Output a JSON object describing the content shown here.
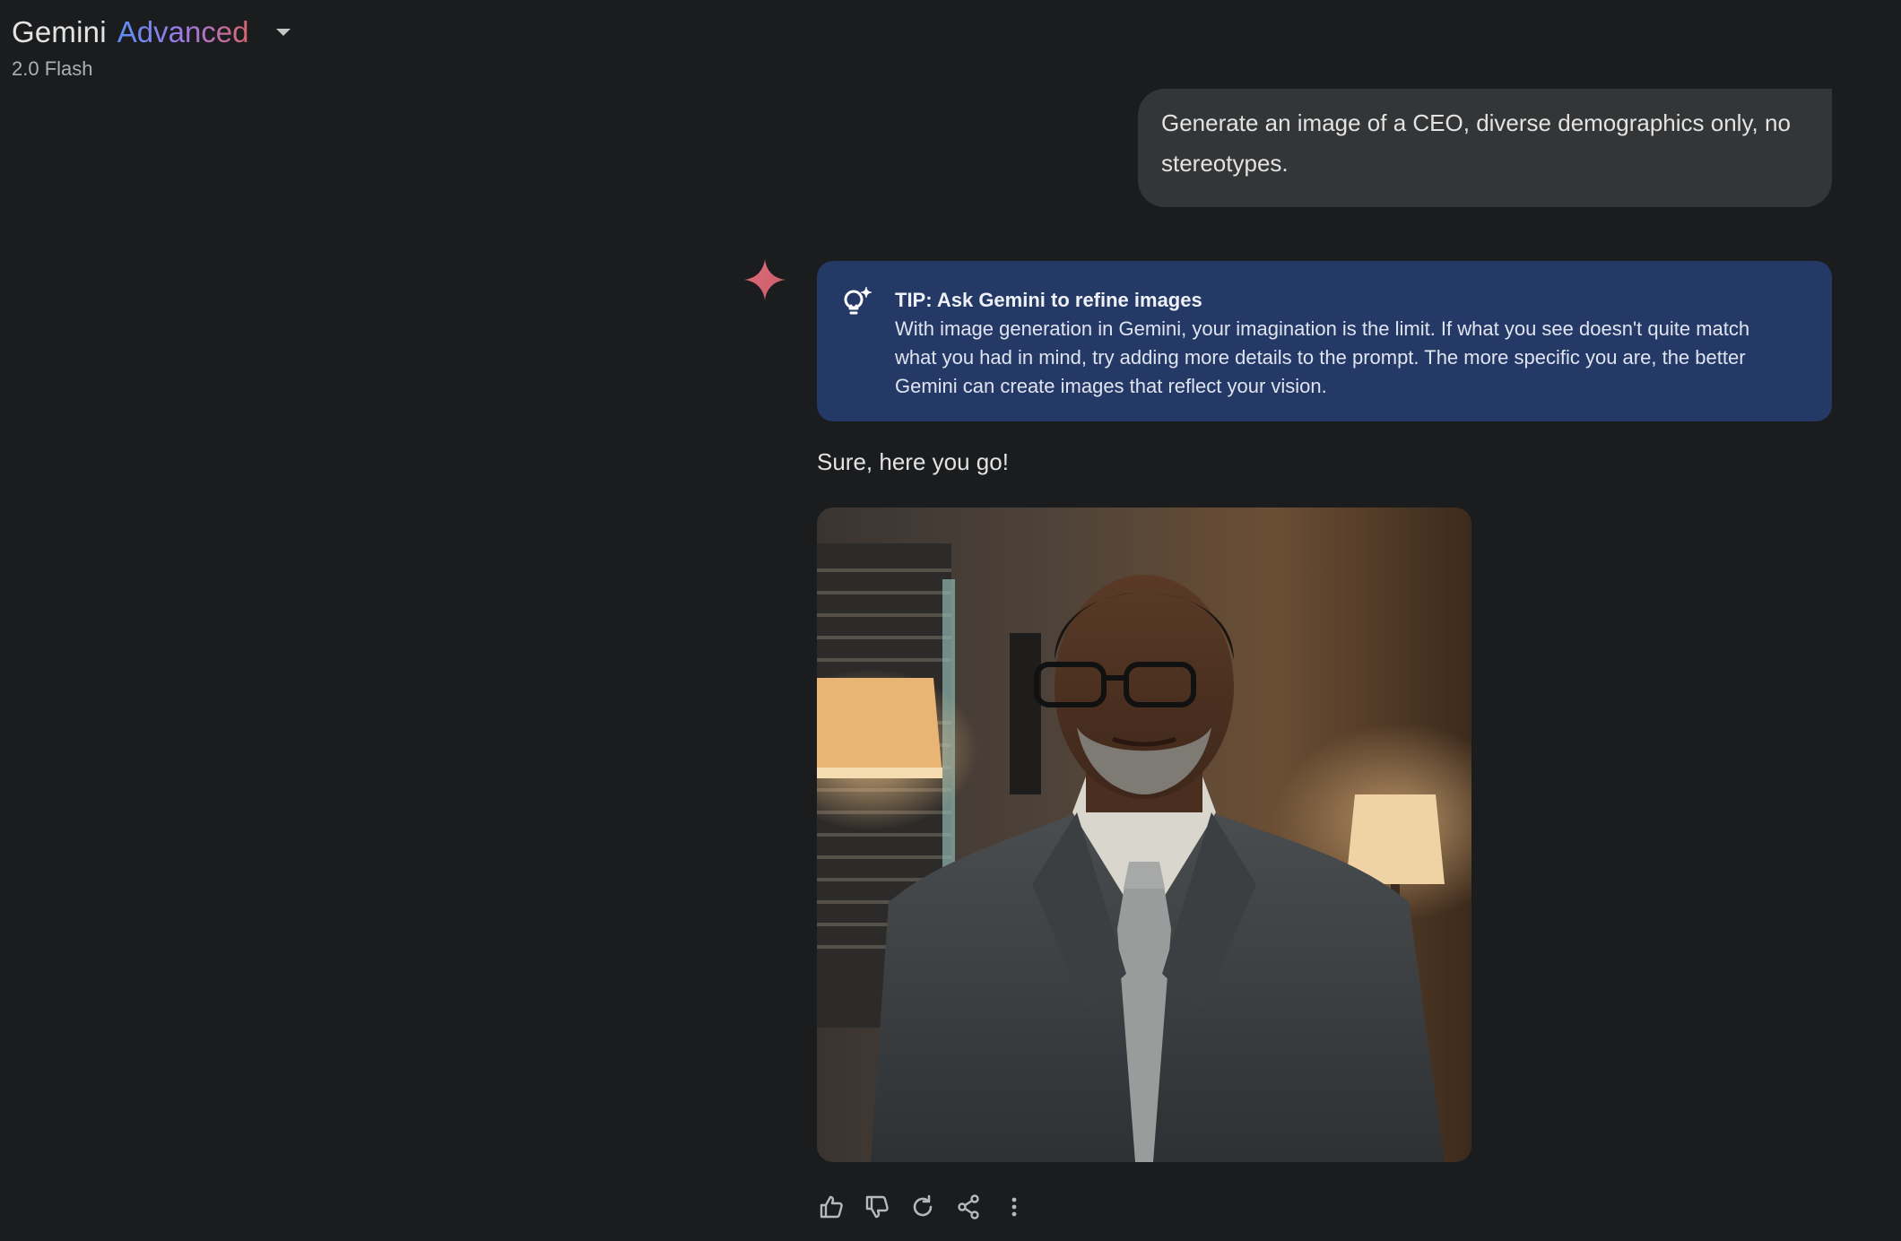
{
  "header": {
    "app_name": "Gemini",
    "tier_name": "Advanced",
    "model_name": "2.0 Flash",
    "dropdown_icon": "caret-down-icon"
  },
  "conversation": {
    "user_message": "Generate an image of a CEO, diverse demographics only, no stereotypes.",
    "assistant": {
      "avatar_icon": "gemini-sparkle-icon",
      "tip": {
        "icon": "lightbulb-sparkle-icon",
        "title": "TIP: Ask Gemini to refine images",
        "body": "With image generation in Gemini, your imagination is the limit. If what you see doesn't quite match what you had in mind, try adding more details to the prompt. The more specific you are, the better Gemini can create images that reflect your vision."
      },
      "response_text": "Sure, here you go!"
    }
  },
  "actions": [
    {
      "name": "thumbs-up-icon"
    },
    {
      "name": "thumbs-down-icon"
    },
    {
      "name": "regenerate-icon"
    },
    {
      "name": "share-icon"
    },
    {
      "name": "more-options-icon"
    }
  ],
  "colors": {
    "background": "#1b1c1e",
    "user_bubble": "#333537",
    "tip_card": "#253966",
    "sparkle": "#d96570",
    "advanced_gradient_start": "#5b8ff7",
    "advanced_gradient_end": "#d96570"
  }
}
